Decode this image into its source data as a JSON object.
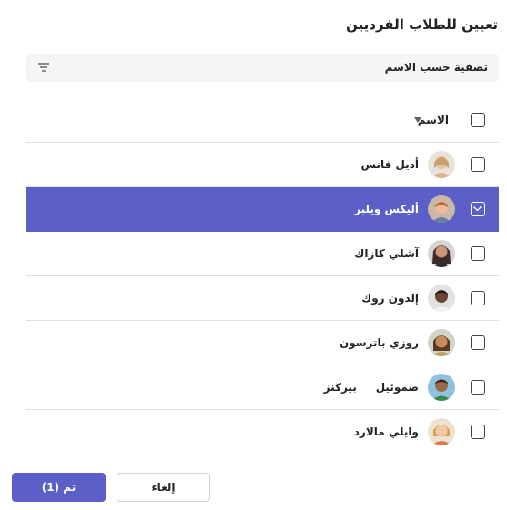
{
  "dialog": {
    "title": "تعيين للطلاب الفرديين"
  },
  "filter": {
    "label": "تصفية حسب الاسم"
  },
  "list": {
    "header_label": "الاسم",
    "students": [
      {
        "name": "أديل فانس",
        "selected": false,
        "avatar_color": "#d9b48f"
      },
      {
        "name": "أليكس ويلبر",
        "selected": true,
        "avatar_color": "#d99a6c"
      },
      {
        "name": "آشلي كازاك",
        "selected": false,
        "avatar_color": "#3a2a28"
      },
      {
        "name": "إلدون روك",
        "selected": false,
        "avatar_color": "#2b1d16"
      },
      {
        "name": "روزي باترسون",
        "selected": false,
        "avatar_color": "#8a5a3a"
      },
      {
        "name": "صموئيل     بيركنز",
        "selected": false,
        "avatar_color": "#6a3d22"
      },
      {
        "name": "وايلي مالارد",
        "selected": false,
        "avatar_color": "#e0b070"
      }
    ]
  },
  "footer": {
    "cancel_label": "إلغاء",
    "done_label": "تم (1)"
  },
  "colors": {
    "accent": "#5b5fc7",
    "divider": "#e0e0e0",
    "filter_bg": "#f5f5f5"
  }
}
